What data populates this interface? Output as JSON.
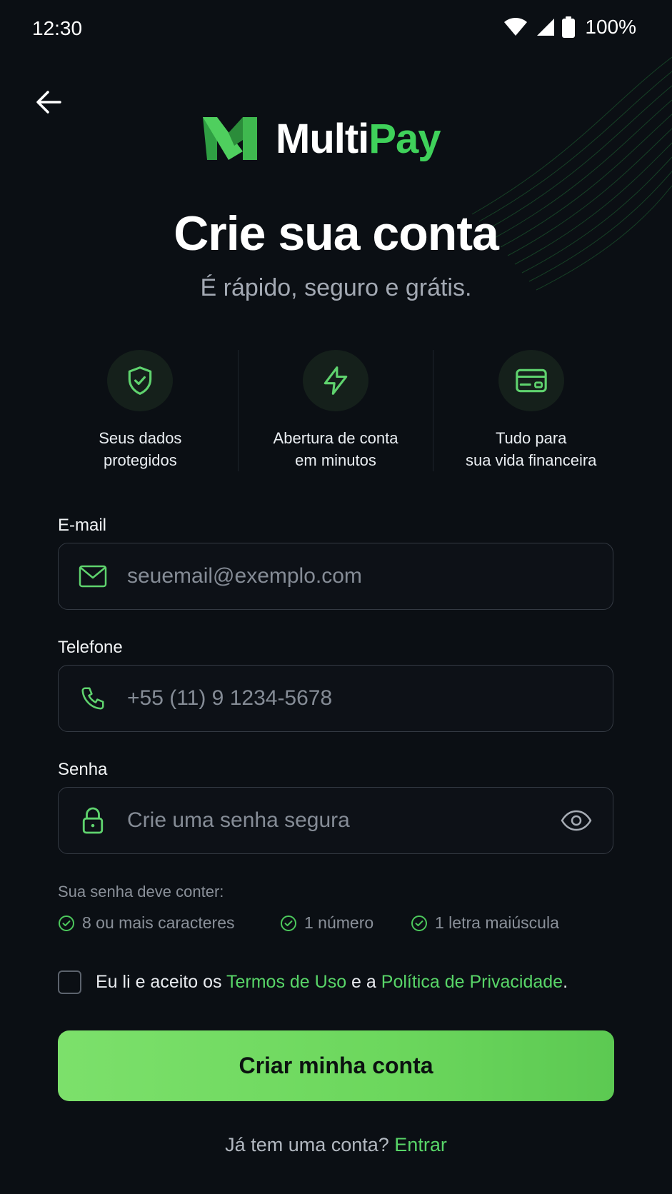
{
  "status_bar": {
    "time": "12:30",
    "battery_text": "100%"
  },
  "logo": {
    "text_part1": "Multi",
    "text_part2": "Pay"
  },
  "header": {
    "title": "Crie sua conta",
    "subtitle": "É rápido, seguro e grátis."
  },
  "features": [
    {
      "icon": "shield-check-icon",
      "label": "Seus dados\nprotegidos"
    },
    {
      "icon": "lightning-icon",
      "label": "Abertura de conta\nem minutos"
    },
    {
      "icon": "card-icon",
      "label": "Tudo para\nsua vida financeira"
    }
  ],
  "form": {
    "email": {
      "label": "E-mail",
      "placeholder": "seuemail@exemplo.com",
      "value": ""
    },
    "phone": {
      "label": "Telefone",
      "placeholder": "+55 (11) 9 1234-5678",
      "value": ""
    },
    "password": {
      "label": "Senha",
      "placeholder": "Crie uma senha segura",
      "value": ""
    },
    "password_hint": "Sua senha deve conter:",
    "password_rules": [
      "8 ou mais caracteres",
      "1 número",
      "1 letra maiúscula"
    ]
  },
  "terms": {
    "prefix": "Eu li e aceito os ",
    "terms_link": "Termos de Uso",
    "middle": " e a ",
    "privacy_link": "Política de Privacidade",
    "suffix": "."
  },
  "submit_label": "Criar minha conta",
  "signin": {
    "prompt": "Já tem uma conta? ",
    "link": "Entrar"
  },
  "colors": {
    "accent": "#3fd15a",
    "background": "#0b0f14",
    "button": "#6cd75d"
  }
}
